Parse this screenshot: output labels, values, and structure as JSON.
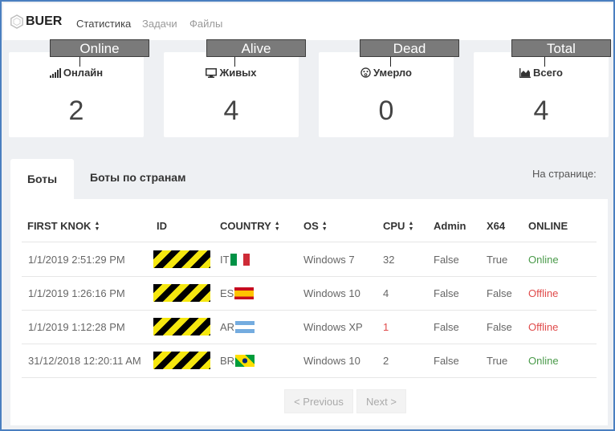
{
  "nav": {
    "brand": "BUER",
    "links": [
      "Статистика",
      "Задачи",
      "Файлы"
    ]
  },
  "annotations": [
    "Online",
    "Alive",
    "Dead",
    "Total"
  ],
  "cards": [
    {
      "label": "Онлайн",
      "value": "2",
      "icon": "signal-icon"
    },
    {
      "label": "Живых",
      "value": "4",
      "icon": "monitor-icon"
    },
    {
      "label": "Умерло",
      "value": "0",
      "icon": "dizzy-face-icon"
    },
    {
      "label": "Всего",
      "value": "4",
      "icon": "area-chart-icon"
    }
  ],
  "tabs": [
    "Боты",
    "Боты по странам"
  ],
  "per_page_label": "На странице:",
  "table": {
    "headers": [
      "FIRST KNOK",
      "ID",
      "COUNTRY",
      "OS",
      "CPU",
      "Admin",
      "X64",
      "ONLINE"
    ],
    "rows": [
      {
        "first_knok": "1/1/2019 2:51:29 PM",
        "country": "IT",
        "os": "Windows 7",
        "cpu": "32",
        "admin": "False",
        "x64": "True",
        "online": "Online"
      },
      {
        "first_knok": "1/1/2019 1:26:16 PM",
        "country": "ES",
        "os": "Windows 10",
        "cpu": "4",
        "admin": "False",
        "x64": "False",
        "online": "Offline"
      },
      {
        "first_knok": "1/1/2019 1:12:28 PM",
        "country": "AR",
        "os": "Windows XP",
        "cpu": "1",
        "admin": "False",
        "x64": "False",
        "online": "Offline"
      },
      {
        "first_knok": "31/12/2018 12:20:11 AM",
        "country": "BR",
        "os": "Windows 10",
        "cpu": "2",
        "admin": "False",
        "x64": "True",
        "online": "Online"
      }
    ]
  },
  "pagination": {
    "previous": "< Previous",
    "next": "Next >"
  },
  "colors": {
    "online": "#4a9a4a",
    "offline": "#e04b4b",
    "frame": "#4a7fc0"
  }
}
